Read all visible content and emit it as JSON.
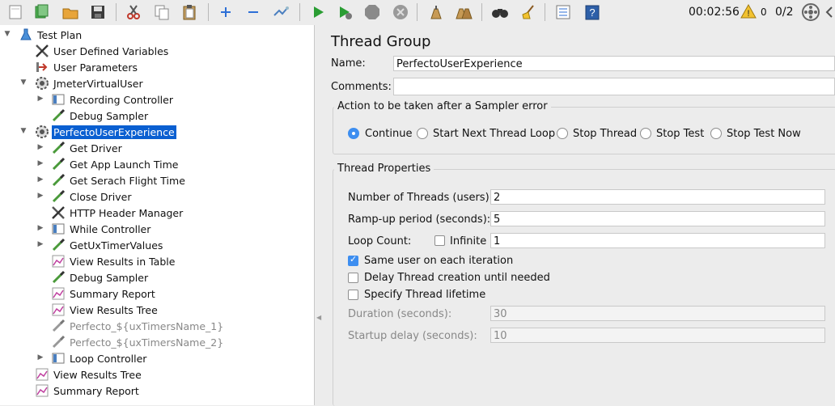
{
  "toolbar": {
    "elapsed_time": "00:02:56",
    "warning_count": "0",
    "thread_ratio": "0/2",
    "colors": {
      "start_green": "#2a9d33",
      "warning_yellow": "#f2c230"
    }
  },
  "tree": {
    "items": [
      {
        "label": "Test Plan",
        "icon": "flask-icon"
      },
      {
        "label": "User Defined Variables",
        "icon": "tools-icon"
      },
      {
        "label": "User Parameters",
        "icon": "preprocessor-icon"
      },
      {
        "label": "JmeterVirtualUser",
        "icon": "gear-icon"
      },
      {
        "label": "Recording Controller",
        "icon": "controller-icon"
      },
      {
        "label": "Debug Sampler",
        "icon": "pipette-icon"
      },
      {
        "label": "PerfectoUserExperience",
        "icon": "gear-icon"
      },
      {
        "label": "Get Driver",
        "icon": "pipette-icon"
      },
      {
        "label": "Get App Launch Time",
        "icon": "pipette-icon"
      },
      {
        "label": "Get Serach Flight Time",
        "icon": "pipette-icon"
      },
      {
        "label": "Close Driver",
        "icon": "pipette-icon"
      },
      {
        "label": "HTTP Header Manager",
        "icon": "tools-icon"
      },
      {
        "label": "While Controller",
        "icon": "controller-icon"
      },
      {
        "label": "GetUxTimerValues",
        "icon": "pipette-icon"
      },
      {
        "label": "View Results in Table",
        "icon": "graph-icon"
      },
      {
        "label": "Debug Sampler",
        "icon": "pipette-icon"
      },
      {
        "label": "Summary Report",
        "icon": "graph-icon"
      },
      {
        "label": "View Results Tree",
        "icon": "graph-icon"
      },
      {
        "label": "Perfecto_${uxTimersName_1}",
        "icon": "pipette-icon"
      },
      {
        "label": "Perfecto_${uxTimersName_2}",
        "icon": "pipette-icon"
      },
      {
        "label": "Loop Controller",
        "icon": "controller-icon"
      },
      {
        "label": "View Results Tree",
        "icon": "graph-icon"
      },
      {
        "label": "Summary Report",
        "icon": "graph-icon"
      }
    ]
  },
  "panel": {
    "title": "Thread Group",
    "name_label": "Name:",
    "name_value": "PerfectoUserExperience",
    "comments_label": "Comments:",
    "comments_value": "",
    "sampler_error": {
      "legend": "Action to be taken after a Sampler error",
      "options": [
        "Continue",
        "Start Next Thread Loop",
        "Stop Thread",
        "Stop Test",
        "Stop Test Now"
      ],
      "selected": "Continue"
    },
    "thread_props": {
      "legend": "Thread Properties",
      "threads_label": "Number of Threads (users):",
      "threads_value": "2",
      "rampup_label": "Ramp-up period (seconds):",
      "rampup_value": "5",
      "loop_label": "Loop Count:",
      "infinite_label": "Infinite",
      "loop_value": "1",
      "same_user_label": "Same user on each iteration",
      "delay_label": "Delay Thread creation until needed",
      "lifetime_label": "Specify Thread lifetime",
      "duration_label": "Duration (seconds):",
      "duration_value": "30",
      "startup_label": "Startup delay (seconds):",
      "startup_value": "10"
    }
  }
}
